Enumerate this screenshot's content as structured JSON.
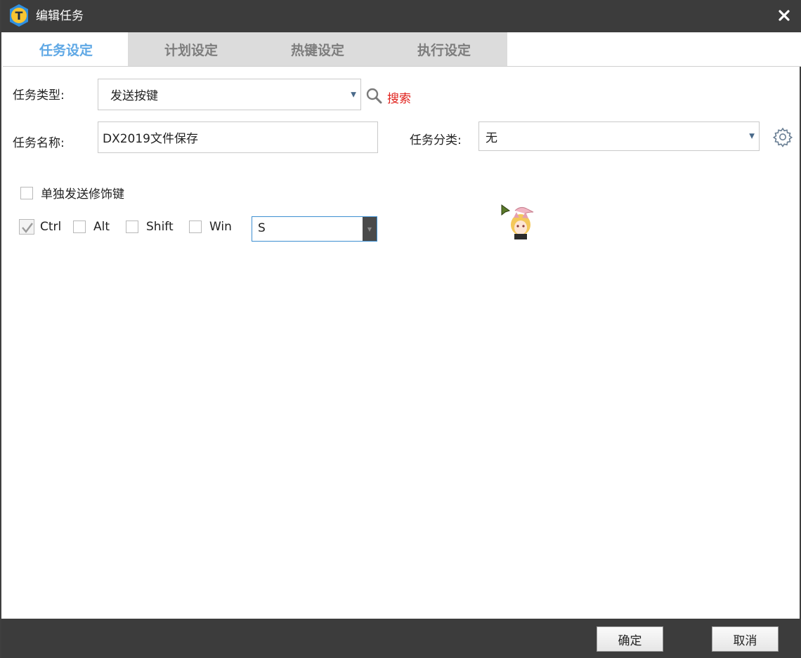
{
  "window": {
    "title": "编辑任务"
  },
  "tabs": [
    {
      "label": "任务设定",
      "active": true
    },
    {
      "label": "计划设定",
      "active": false
    },
    {
      "label": "热键设定",
      "active": false
    },
    {
      "label": "执行设定",
      "active": false
    }
  ],
  "form": {
    "task_type_label": "任务类型:",
    "task_type_value": "发送按键",
    "search_label": "搜索",
    "task_name_label": "任务名称:",
    "task_name_value": "DX2019文件保存",
    "category_label": "任务分类:",
    "category_value": "无"
  },
  "options": {
    "send_modifier_alone": {
      "label": "单独发送修饰键",
      "checked": false
    },
    "modifiers": [
      {
        "label": "Ctrl",
        "checked": true
      },
      {
        "label": "Alt",
        "checked": false
      },
      {
        "label": "Shift",
        "checked": false
      },
      {
        "label": "Win",
        "checked": false
      }
    ],
    "key_value": "S"
  },
  "footer": {
    "ok_label": "确定",
    "cancel_label": "取消"
  },
  "colors": {
    "titlebar": "#3c3c3c",
    "tab_active_text": "#5fa8e5",
    "tab_inactive_bg": "#dcdcdc",
    "search_link": "#e0201b",
    "key_combo_border": "#3d8fd1"
  },
  "icons": {
    "app": "app-logo-icon",
    "close": "close-icon",
    "search": "search-icon",
    "settings": "gear-icon",
    "dropdown": "chevron-down-icon"
  }
}
